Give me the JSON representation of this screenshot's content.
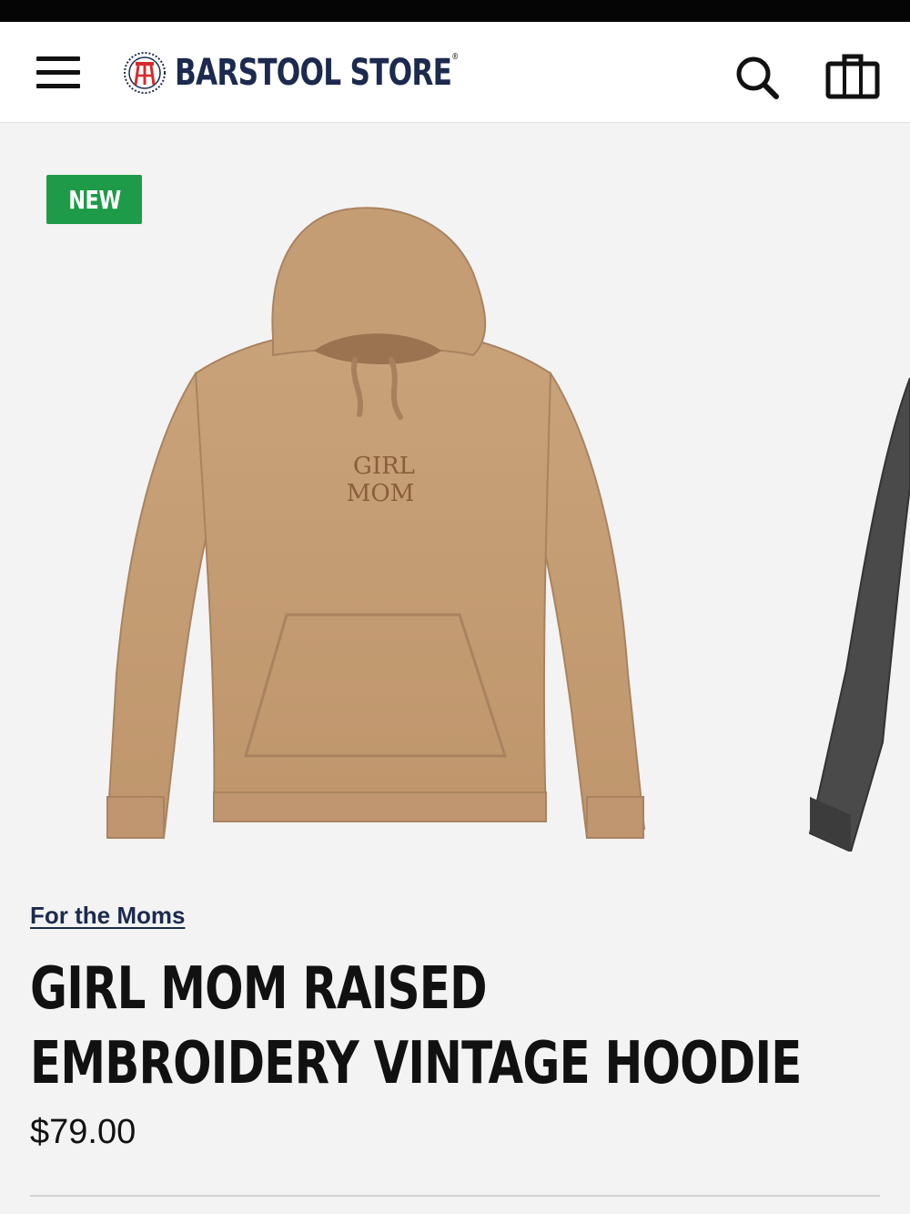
{
  "header": {
    "brand": "BARSTOOL STORE",
    "registered_mark": "®"
  },
  "icons": {
    "menu": "hamburger-menu-icon",
    "logo": "barstool-stool-icon",
    "search": "search-icon",
    "cart": "shopping-bag-icon"
  },
  "colors": {
    "brand_navy": "#1b2a4e",
    "badge_green": "#1e9b48",
    "hoodie_tan": "#c49a70",
    "page_background": "#f3f3f3"
  },
  "product": {
    "badge": "NEW",
    "embroidery_line1": "GIRL",
    "embroidery_line2": "MOM",
    "category": "For the Moms",
    "title": "GIRL MOM RAISED EMBROIDERY VINTAGE HOODIE",
    "price": "$79.00"
  }
}
